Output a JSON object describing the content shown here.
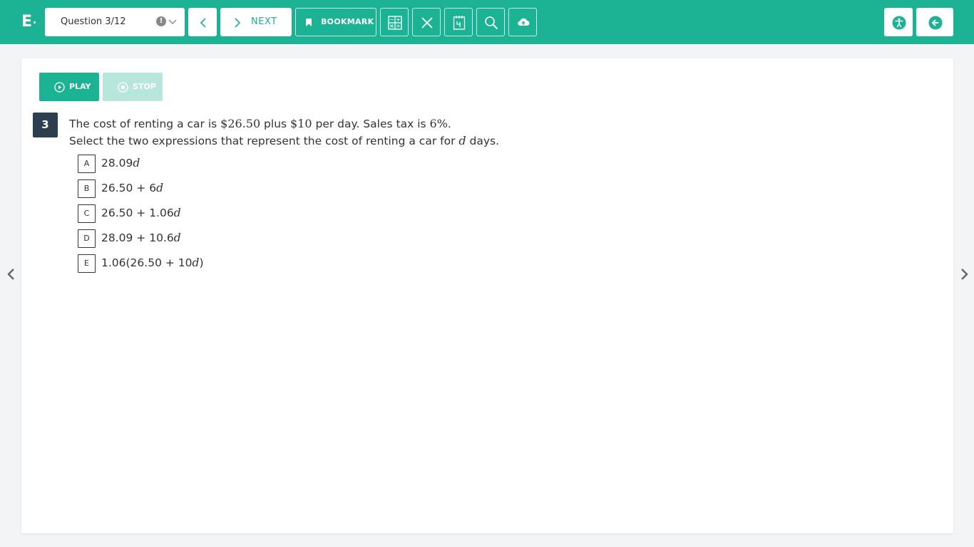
{
  "header": {
    "logo": "E",
    "question_selector": "Question 3/12",
    "warning_glyph": "!",
    "next_label": "NEXT",
    "bookmark_label": "BOOKMARK",
    "accent_color": "#1bb394"
  },
  "audio": {
    "play_label": "PLAY",
    "stop_label": "STOP"
  },
  "question": {
    "number": "3",
    "stem_line1_a": "The cost of renting a car is ",
    "stem_line1_m1": "$26.50",
    "stem_line1_b": " plus ",
    "stem_line1_m2": "$10",
    "stem_line1_c": " per day. Sales tax is ",
    "stem_line1_m3": "6%",
    "stem_line1_d": ".",
    "stem_line2_a": "Select the two expressions that represent the cost of renting a car for ",
    "stem_line2_var": "d",
    "stem_line2_b": " days.",
    "choices": [
      {
        "letter": "A",
        "pre": "28.09",
        "var": "d",
        "post": ""
      },
      {
        "letter": "B",
        "pre": "26.50 + 6",
        "var": "d",
        "post": ""
      },
      {
        "letter": "C",
        "pre": "26.50 + 1.06",
        "var": "d",
        "post": ""
      },
      {
        "letter": "D",
        "pre": "28.09 + 10.6",
        "var": "d",
        "post": ""
      },
      {
        "letter": "E",
        "pre": "1.06(26.50 + 10",
        "var": "d",
        "post": ")"
      }
    ]
  }
}
